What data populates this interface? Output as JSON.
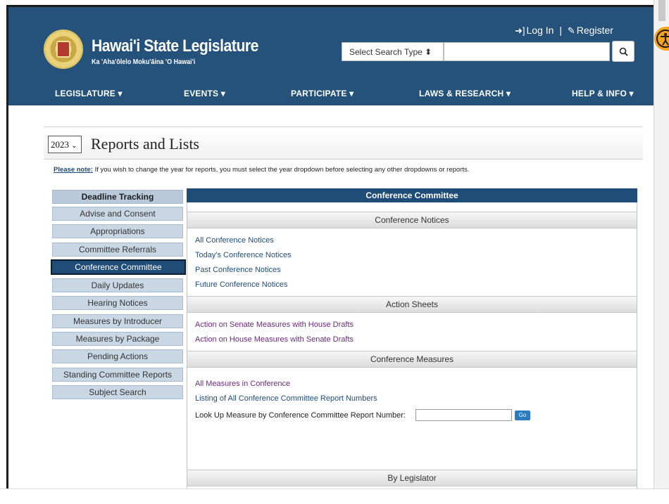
{
  "header": {
    "site_title": "Hawai'i State Legislature",
    "site_subtitle": "Ka 'Aha'ōlelo Moku'āina 'O Hawai'i",
    "login_label": "Log In",
    "separator": "|",
    "register_label": "Register",
    "search_type_label": "Select Search Type ⬍",
    "search_input_value": "",
    "brand_color": "#24527a"
  },
  "nav": {
    "items": [
      {
        "label": "LEGISLATURE ▾"
      },
      {
        "label": "EVENTS ▾"
      },
      {
        "label": "PARTICIPATE ▾"
      },
      {
        "label": "LAWS & RESEARCH ▾"
      },
      {
        "label": "HELP & INFO ▾"
      }
    ]
  },
  "page": {
    "year_value": "2023",
    "title": "Reports and Lists",
    "note_label": "Please note:",
    "note_text": " If you wish to change the year for reports, you must select the year dropdown before selecting any other dropdowns or reports."
  },
  "sidebar": {
    "items": [
      {
        "label": "Deadline Tracking"
      },
      {
        "label": "Advise and Consent"
      },
      {
        "label": "Appropriations"
      },
      {
        "label": "Committee Referrals"
      },
      {
        "label": "Conference Committee"
      },
      {
        "label": "Daily Updates"
      },
      {
        "label": "Hearing Notices"
      },
      {
        "label": "Measures by Introducer"
      },
      {
        "label": "Measures by Package"
      },
      {
        "label": "Pending Actions"
      },
      {
        "label": "Standing Committee Reports"
      },
      {
        "label": "Subject Search"
      }
    ]
  },
  "panel": {
    "title": "Conference Committee",
    "sections": [
      {
        "title": "Conference Notices"
      },
      {
        "title": "Action Sheets"
      },
      {
        "title": "Conference Measures"
      },
      {
        "title": "By Legislator"
      }
    ],
    "links": {
      "all_notices": "All Conference Notices",
      "todays_notices": "Today's Conference Notices",
      "past_notices": "Past Conference Notices",
      "future_notices": "Future Conference Notices",
      "senate_with_house": "Action on Senate Measures with House Drafts",
      "house_with_senate": "Action on House Measures with Senate Drafts",
      "all_measures": "All Measures in Conference",
      "report_numbers": "Listing of All Conference Committee Report Numbers"
    },
    "lookup_label": "Look Up Measure by Conference Committee Report Number:",
    "lookup_value": "",
    "go_label": "Go"
  }
}
